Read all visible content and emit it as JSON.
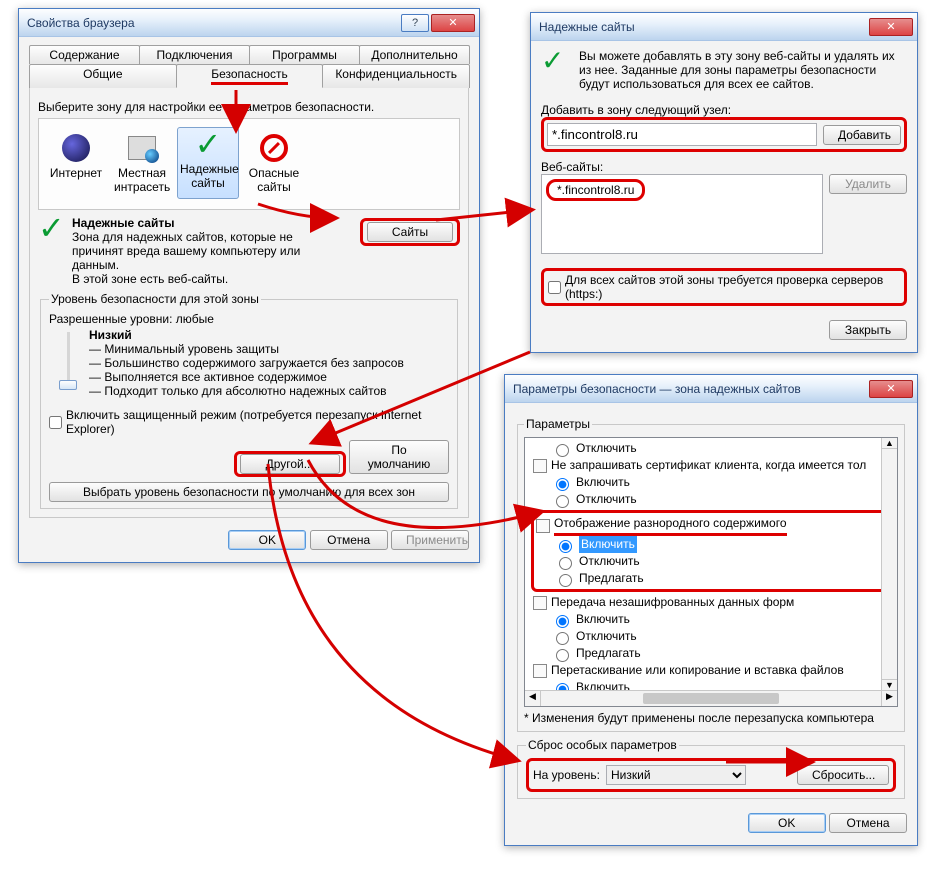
{
  "window1": {
    "title": "Свойства браузера",
    "tabs_row1": [
      "Содержание",
      "Подключения",
      "Программы",
      "Дополнительно"
    ],
    "tabs_row2": [
      "Общие",
      "Безопасность",
      "Конфиденциальность"
    ],
    "zone_instruction": "Выберите зону для настройки ее параметров безопасности.",
    "zones": {
      "internet": "Интернет",
      "intranet": "Местная интрасеть",
      "trusted": "Надежные сайты",
      "restricted": "Опасные сайты"
    },
    "trusted_header": "Надежные сайты",
    "trusted_desc1": "Зона для надежных сайтов, которые не причинят вреда вашему компьютеру или данным.",
    "trusted_desc2": "В этой зоне есть веб-сайты.",
    "sites_btn": "Сайты",
    "level_legend": "Уровень безопасности для этой зоны",
    "level_allowed": "Разрешенные уровни: любые",
    "level_name": "Низкий",
    "bullets": [
      "Минимальный уровень защиты",
      "Большинство содержимого загружается без запросов",
      "Выполняется все активное содержимое",
      "Подходит только для абсолютно надежных сайтов"
    ],
    "protect_chk": "Включить защищенный режим (потребуется перезапуск Internet Explorer)",
    "custom_btn": "Другой...",
    "default_btn": "По умолчанию",
    "reset_all_btn": "Выбрать уровень безопасности по умолчанию для всех зон",
    "ok": "OK",
    "cancel": "Отмена",
    "apply": "Применить"
  },
  "window2": {
    "title": "Надежные сайты",
    "intro": "Вы можете добавлять в эту зону веб-сайты и удалять их из нее. Заданные для зоны параметры безопасности будут использоваться для всех ее сайтов.",
    "add_label": "Добавить в зону следующий узел:",
    "add_value": "*.fincontrol8.ru",
    "add_btn": "Добавить",
    "sites_label": "Веб-сайты:",
    "site_entry": "*.fincontrol8.ru",
    "remove_btn": "Удалить",
    "https_chk": "Для всех сайтов этой зоны требуется проверка серверов (https:)",
    "close_btn": "Закрыть"
  },
  "window3": {
    "title": "Параметры безопасности — зона надежных сайтов",
    "legend": "Параметры",
    "opt_disable": "Отключить",
    "opt_enable": "Включить",
    "opt_prompt": "Предлагать",
    "grp_nocert": "Не запрашивать сертификат клиента, когда имеется тол",
    "grp_mixed": "Отображение разнородного содержимого",
    "grp_unenc": "Передача незашифрованных данных форм",
    "grp_drag": "Перетаскивание или копирование и вставка файлов",
    "restart_note": "* Изменения будут применены после перезапуска компьютера",
    "reset_legend": "Сброс особых параметров",
    "reset_label": "На уровень:",
    "reset_level": "Низкий",
    "reset_btn": "Сбросить...",
    "ok": "OK",
    "cancel": "Отмена"
  }
}
